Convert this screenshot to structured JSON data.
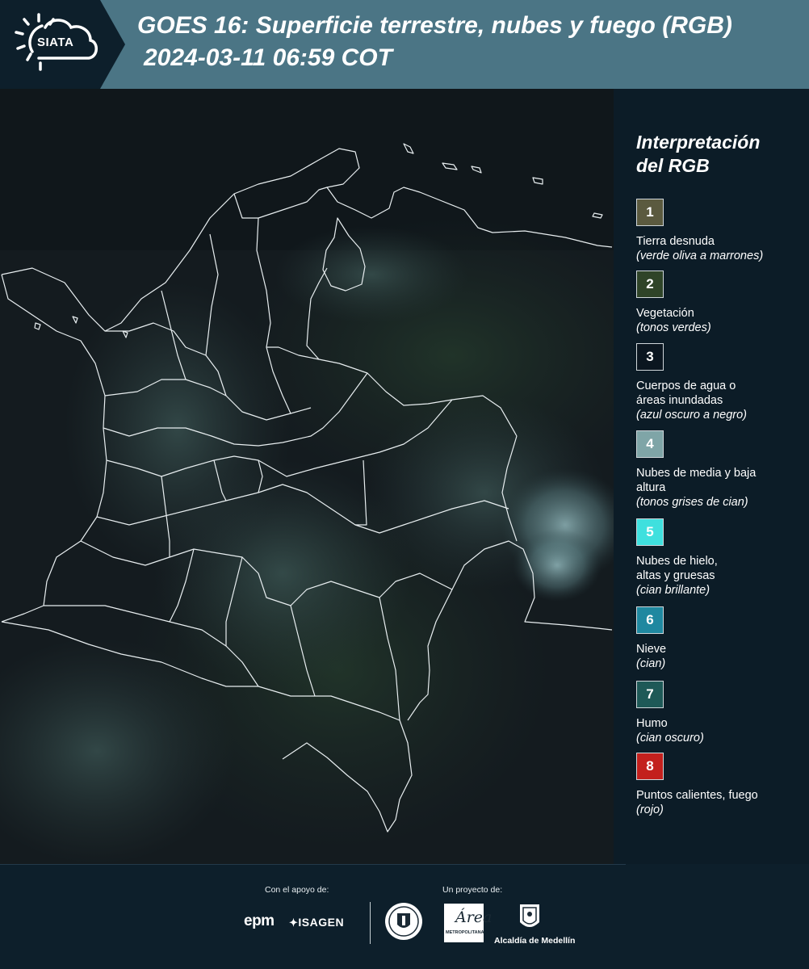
{
  "header": {
    "logo_text": "SIATA",
    "title": "GOES 16: Superficie terrestre, nubes y fuego (RGB)",
    "subtitle": "2024-03-11 06:59 COT"
  },
  "legend": {
    "title_line1": "Interpretación",
    "title_line2": "del RGB",
    "items": [
      {
        "num": "1",
        "color": "#5b5a3f",
        "label": "Tierra desnuda",
        "desc": "(verde oliva a marrones)"
      },
      {
        "num": "2",
        "color": "#2f4428",
        "label": "Vegetación",
        "desc": "(tonos verdes)"
      },
      {
        "num": "3",
        "color": "#0b1620",
        "label": "Cuerpos de agua o áreas inundadas",
        "desc": "(azul oscuro a negro)"
      },
      {
        "num": "4",
        "color": "#7fa5a7",
        "label": "Nubes de media y baja altura",
        "desc": "(tonos grises de cian)"
      },
      {
        "num": "5",
        "color": "#3fe0de",
        "label": "Nubes de hielo, altas y gruesas",
        "desc": "(cian brillante)"
      },
      {
        "num": "6",
        "color": "#1f88a0",
        "label": "Nieve",
        "desc": "(cian)"
      },
      {
        "num": "7",
        "color": "#1e5957",
        "label": "Humo",
        "desc": "(cian oscuro)"
      },
      {
        "num": "8",
        "color": "#c3201d",
        "label": "Puntos calientes, fuego",
        "desc": "(rojo)"
      }
    ]
  },
  "footer": {
    "support_label": "Con el apoyo de:",
    "project_label": "Un proyecto de:",
    "epm": "epm",
    "isagen": "ISAGEN",
    "area_big": "Área",
    "area_small": "METROPOLITANA",
    "alcaldia": "Alcaldía de Medellín"
  }
}
